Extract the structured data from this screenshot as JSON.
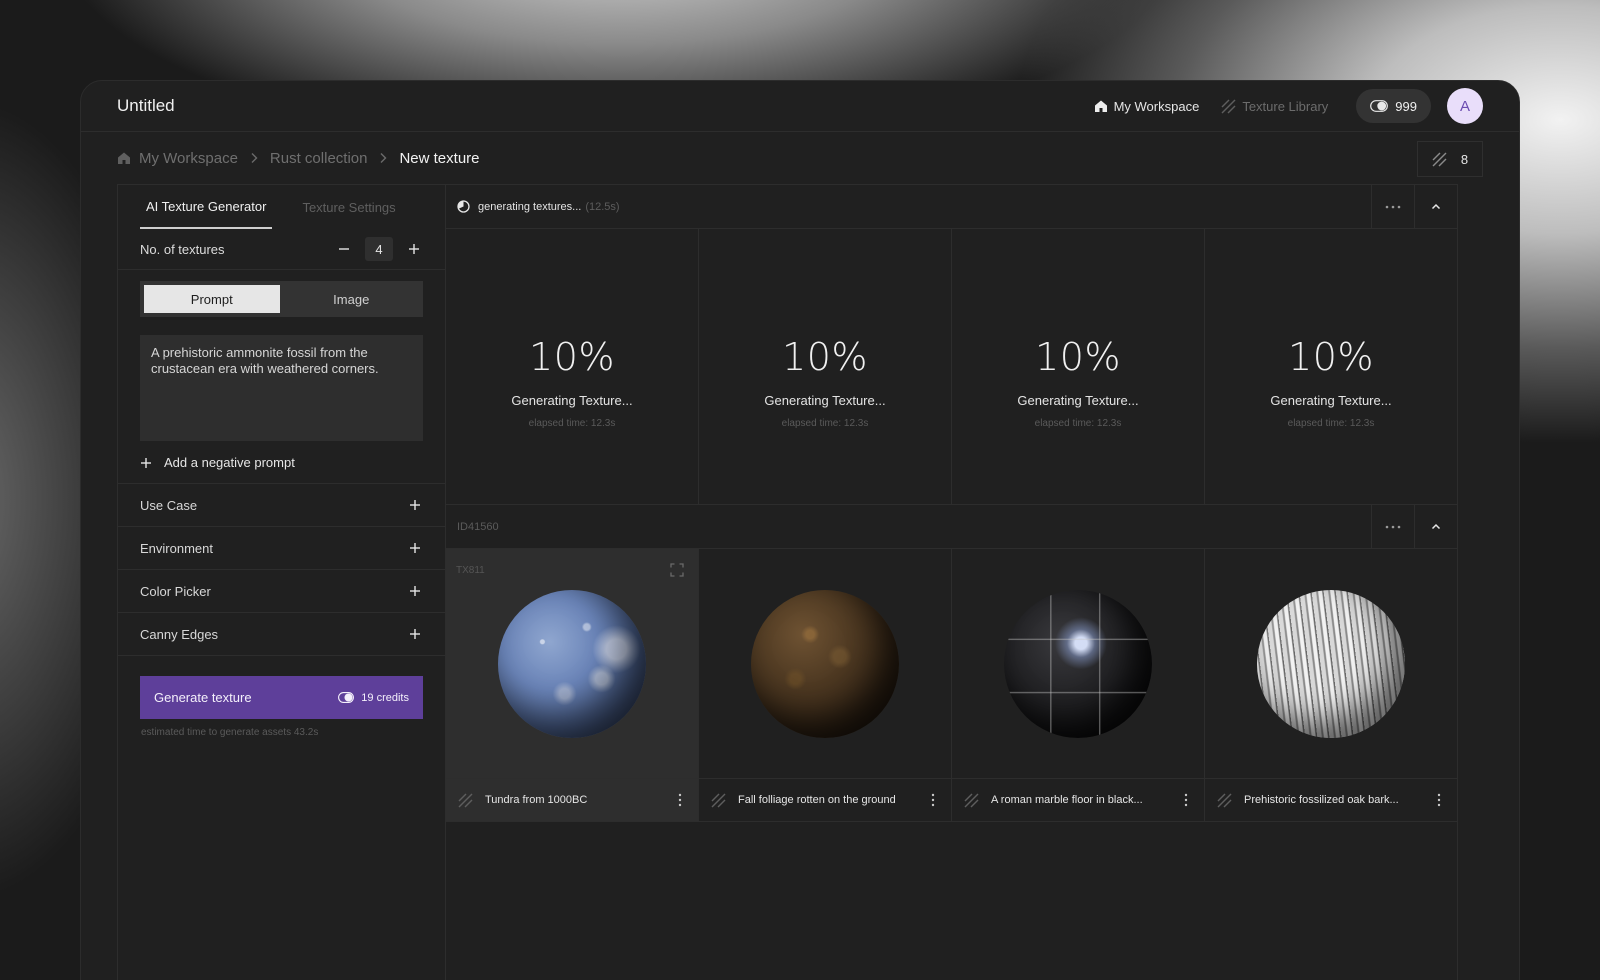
{
  "app": {
    "title": "Untitled"
  },
  "topnav": {
    "workspace_label": "My Workspace",
    "library_label": "Texture Library",
    "credits": "999",
    "avatar_initial": "A"
  },
  "breadcrumb": {
    "items": [
      "My Workspace",
      "Rust collection",
      "New texture"
    ],
    "count": "8"
  },
  "left": {
    "tabs": [
      "AI Texture Generator",
      "Texture Settings"
    ],
    "num_textures_label": "No. of textures",
    "num_textures_value": "4",
    "mode_tabs": [
      "Prompt",
      "Image"
    ],
    "prompt_text": "A prehistoric ammonite fossil from the crustacean era with weathered corners.",
    "negative_prompt_label": "Add a negative prompt",
    "accordions": [
      "Use Case",
      "Environment",
      "Color Picker",
      "Canny Edges"
    ],
    "generate_label": "Generate texture",
    "generate_credits": "19 credits",
    "estimate_text": "estimated time to generate assets 43.2s"
  },
  "generating": {
    "status": "generating textures...",
    "elapsed": "(12.5s)",
    "cells": [
      {
        "percent": "10%",
        "label": "Generating Texture...",
        "elapsed": "elapsed time: 12.3s"
      },
      {
        "percent": "10%",
        "label": "Generating Texture...",
        "elapsed": "elapsed time: 12.3s"
      },
      {
        "percent": "10%",
        "label": "Generating Texture...",
        "elapsed": "elapsed time: 12.3s"
      },
      {
        "percent": "10%",
        "label": "Generating Texture...",
        "elapsed": "elapsed time: 12.3s"
      }
    ]
  },
  "collection": {
    "id": "ID41560",
    "textures": [
      {
        "id": "TX811",
        "name": "Tundra from 1000BC"
      },
      {
        "name": "Fall folliage rotten on the ground"
      },
      {
        "name": "A roman marble floor in black..."
      },
      {
        "name": "Prehistoric fossilized oak bark..."
      }
    ]
  },
  "colors": {
    "accent": "#5e3f9a",
    "avatar_bg": "#e9defa",
    "panel": "#202020"
  }
}
